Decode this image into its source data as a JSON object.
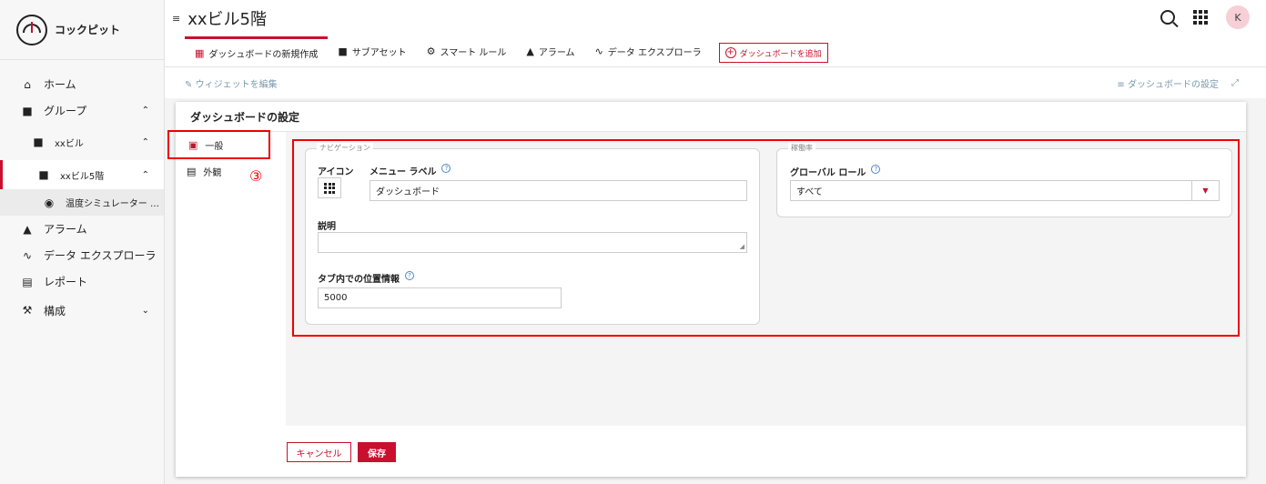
{
  "app": {
    "name": "コックピット"
  },
  "sidebar": {
    "items": [
      {
        "label": "ホーム"
      },
      {
        "label": "グループ"
      },
      {
        "label": "xxビル"
      },
      {
        "label": "xxビル5階"
      },
      {
        "label": "温度シミュレーター …"
      },
      {
        "label": "アラーム"
      },
      {
        "label": "データ エクスプローラ"
      },
      {
        "label": "レポート"
      },
      {
        "label": "構成"
      }
    ]
  },
  "header": {
    "title": "xxビル5階",
    "avatar_initial": "K"
  },
  "tabs": [
    {
      "label": "ダッシュボードの新規作成"
    },
    {
      "label": "サブアセット"
    },
    {
      "label": "スマート ルール"
    },
    {
      "label": "アラーム"
    },
    {
      "label": "データ エクスプローラ"
    }
  ],
  "add_dashboard_label": "ダッシュボードを追加",
  "toolbar": {
    "edit_widgets": "ウィジェットを編集",
    "dashboard_settings": "ダッシュボードの設定"
  },
  "dialog": {
    "title": "ダッシュボードの設定",
    "side_tabs": [
      {
        "label": "一般"
      },
      {
        "label": "外観"
      }
    ],
    "annotation_number": "③",
    "navigation": {
      "legend": "ナビゲーション",
      "icon_label": "アイコン",
      "menu_label_label": "メニュー ラベル",
      "menu_label_value": "ダッシュボード",
      "description_label": "説明",
      "description_value": "",
      "tab_position_label": "タブ内での位置情報",
      "tab_position_value": "5000"
    },
    "availability": {
      "legend": "稼働率",
      "global_role_label": "グローバル ロール",
      "global_role_value": "すべて"
    },
    "cancel_label": "キャンセル",
    "save_label": "保存"
  }
}
